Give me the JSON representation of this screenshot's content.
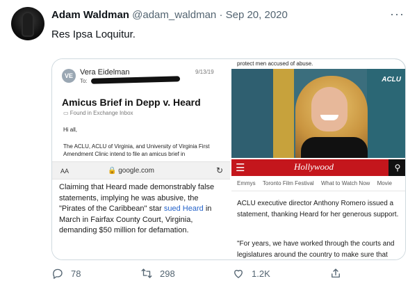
{
  "tweet": {
    "author_name": "Adam Waldman",
    "handle": "@adam_waldman",
    "separator": "·",
    "date": "Sep 20, 2020",
    "more": "···",
    "text": "Res Ipsa Loquitur."
  },
  "email": {
    "avatar_initials": "VE",
    "sender": "Vera Eidelman",
    "to_label": "To:",
    "date": "9/13/19",
    "subject": "Amicus Brief in Depp v. Heard",
    "folder": "Found in Exchange Inbox",
    "greeting": "Hi all,",
    "body": "The ACLU, ACLU of Virginia, and University of Virginia First Amendment Clinic intend to file an amicus brief in",
    "browser_aa": "AA",
    "browser_url": "google.com",
    "article_before_link": "Claiming that Heard made demonstrably false statements, implying he was abusive, the \"Pirates of the Caribbean\" star ",
    "article_link": "sued Heard",
    "article_after_link": " in March in Fairfax County Court, Virginia, demanding $50 million for defamation."
  },
  "photo": {
    "caption": "protect men accused of abuse.",
    "badge": "ACLU"
  },
  "hr_article": {
    "brand": "Hollywood",
    "nav": [
      "Emmys",
      "Toronto Film Festival",
      "What to Watch Now",
      "Movie"
    ],
    "para1": "ACLU executive director Anthony Romero issued a statement, thanking Heard for her generous support.",
    "para2": "\"For years, we have worked through the courts and legislatures around the country to make sure that"
  },
  "actions": {
    "replies": "78",
    "retweets": "298",
    "likes": "1.2K"
  }
}
